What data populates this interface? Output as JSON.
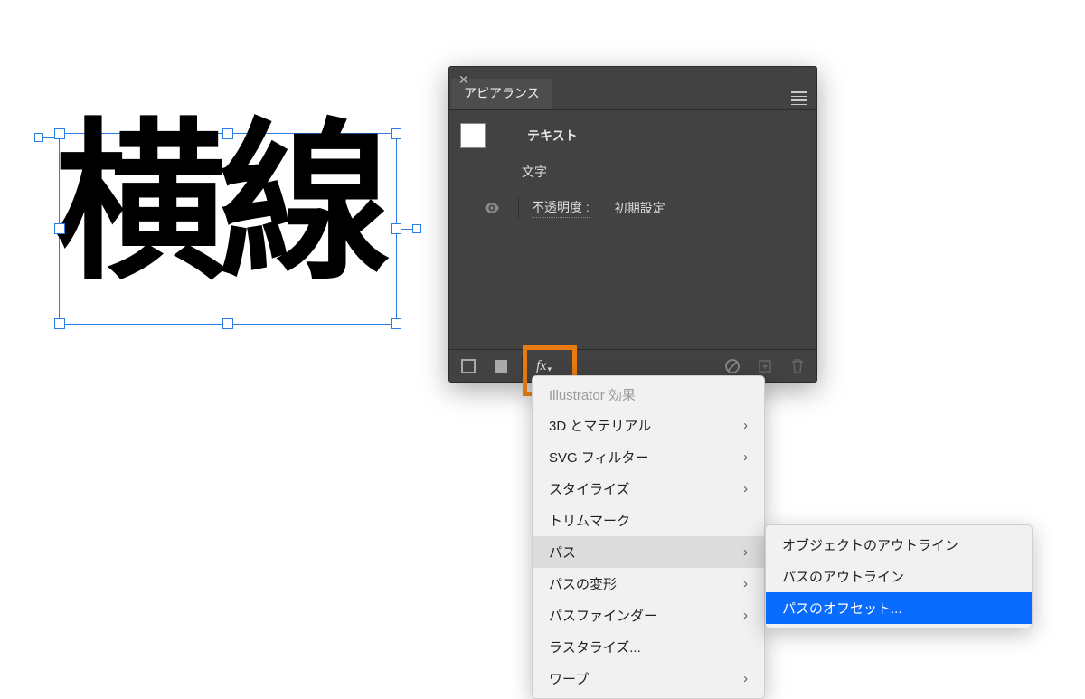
{
  "canvas": {
    "selected_text": "横線"
  },
  "appearance_panel": {
    "title": "アピアランス",
    "rows": {
      "text_label": "テキスト",
      "char_label": "文字",
      "opacity_label": "不透明度 :",
      "opacity_value": "初期設定"
    },
    "fx_label": "fx"
  },
  "fx_menu": {
    "header": "Illustrator 効果",
    "items": [
      {
        "label": "3D とマテリアル",
        "submenu": true
      },
      {
        "label": "SVG フィルター",
        "submenu": true
      },
      {
        "label": "スタイライズ",
        "submenu": true
      },
      {
        "label": "トリムマーク",
        "submenu": false
      },
      {
        "label": "パス",
        "submenu": true,
        "hover": true
      },
      {
        "label": "パスの変形",
        "submenu": true
      },
      {
        "label": "パスファインダー",
        "submenu": true
      },
      {
        "label": "ラスタライズ...",
        "submenu": false
      },
      {
        "label": "ワープ",
        "submenu": true
      }
    ]
  },
  "path_submenu": {
    "items": [
      {
        "label": "オブジェクトのアウトライン"
      },
      {
        "label": "パスのアウトライン"
      },
      {
        "label": "パスのオフセット...",
        "selected": true
      }
    ]
  }
}
